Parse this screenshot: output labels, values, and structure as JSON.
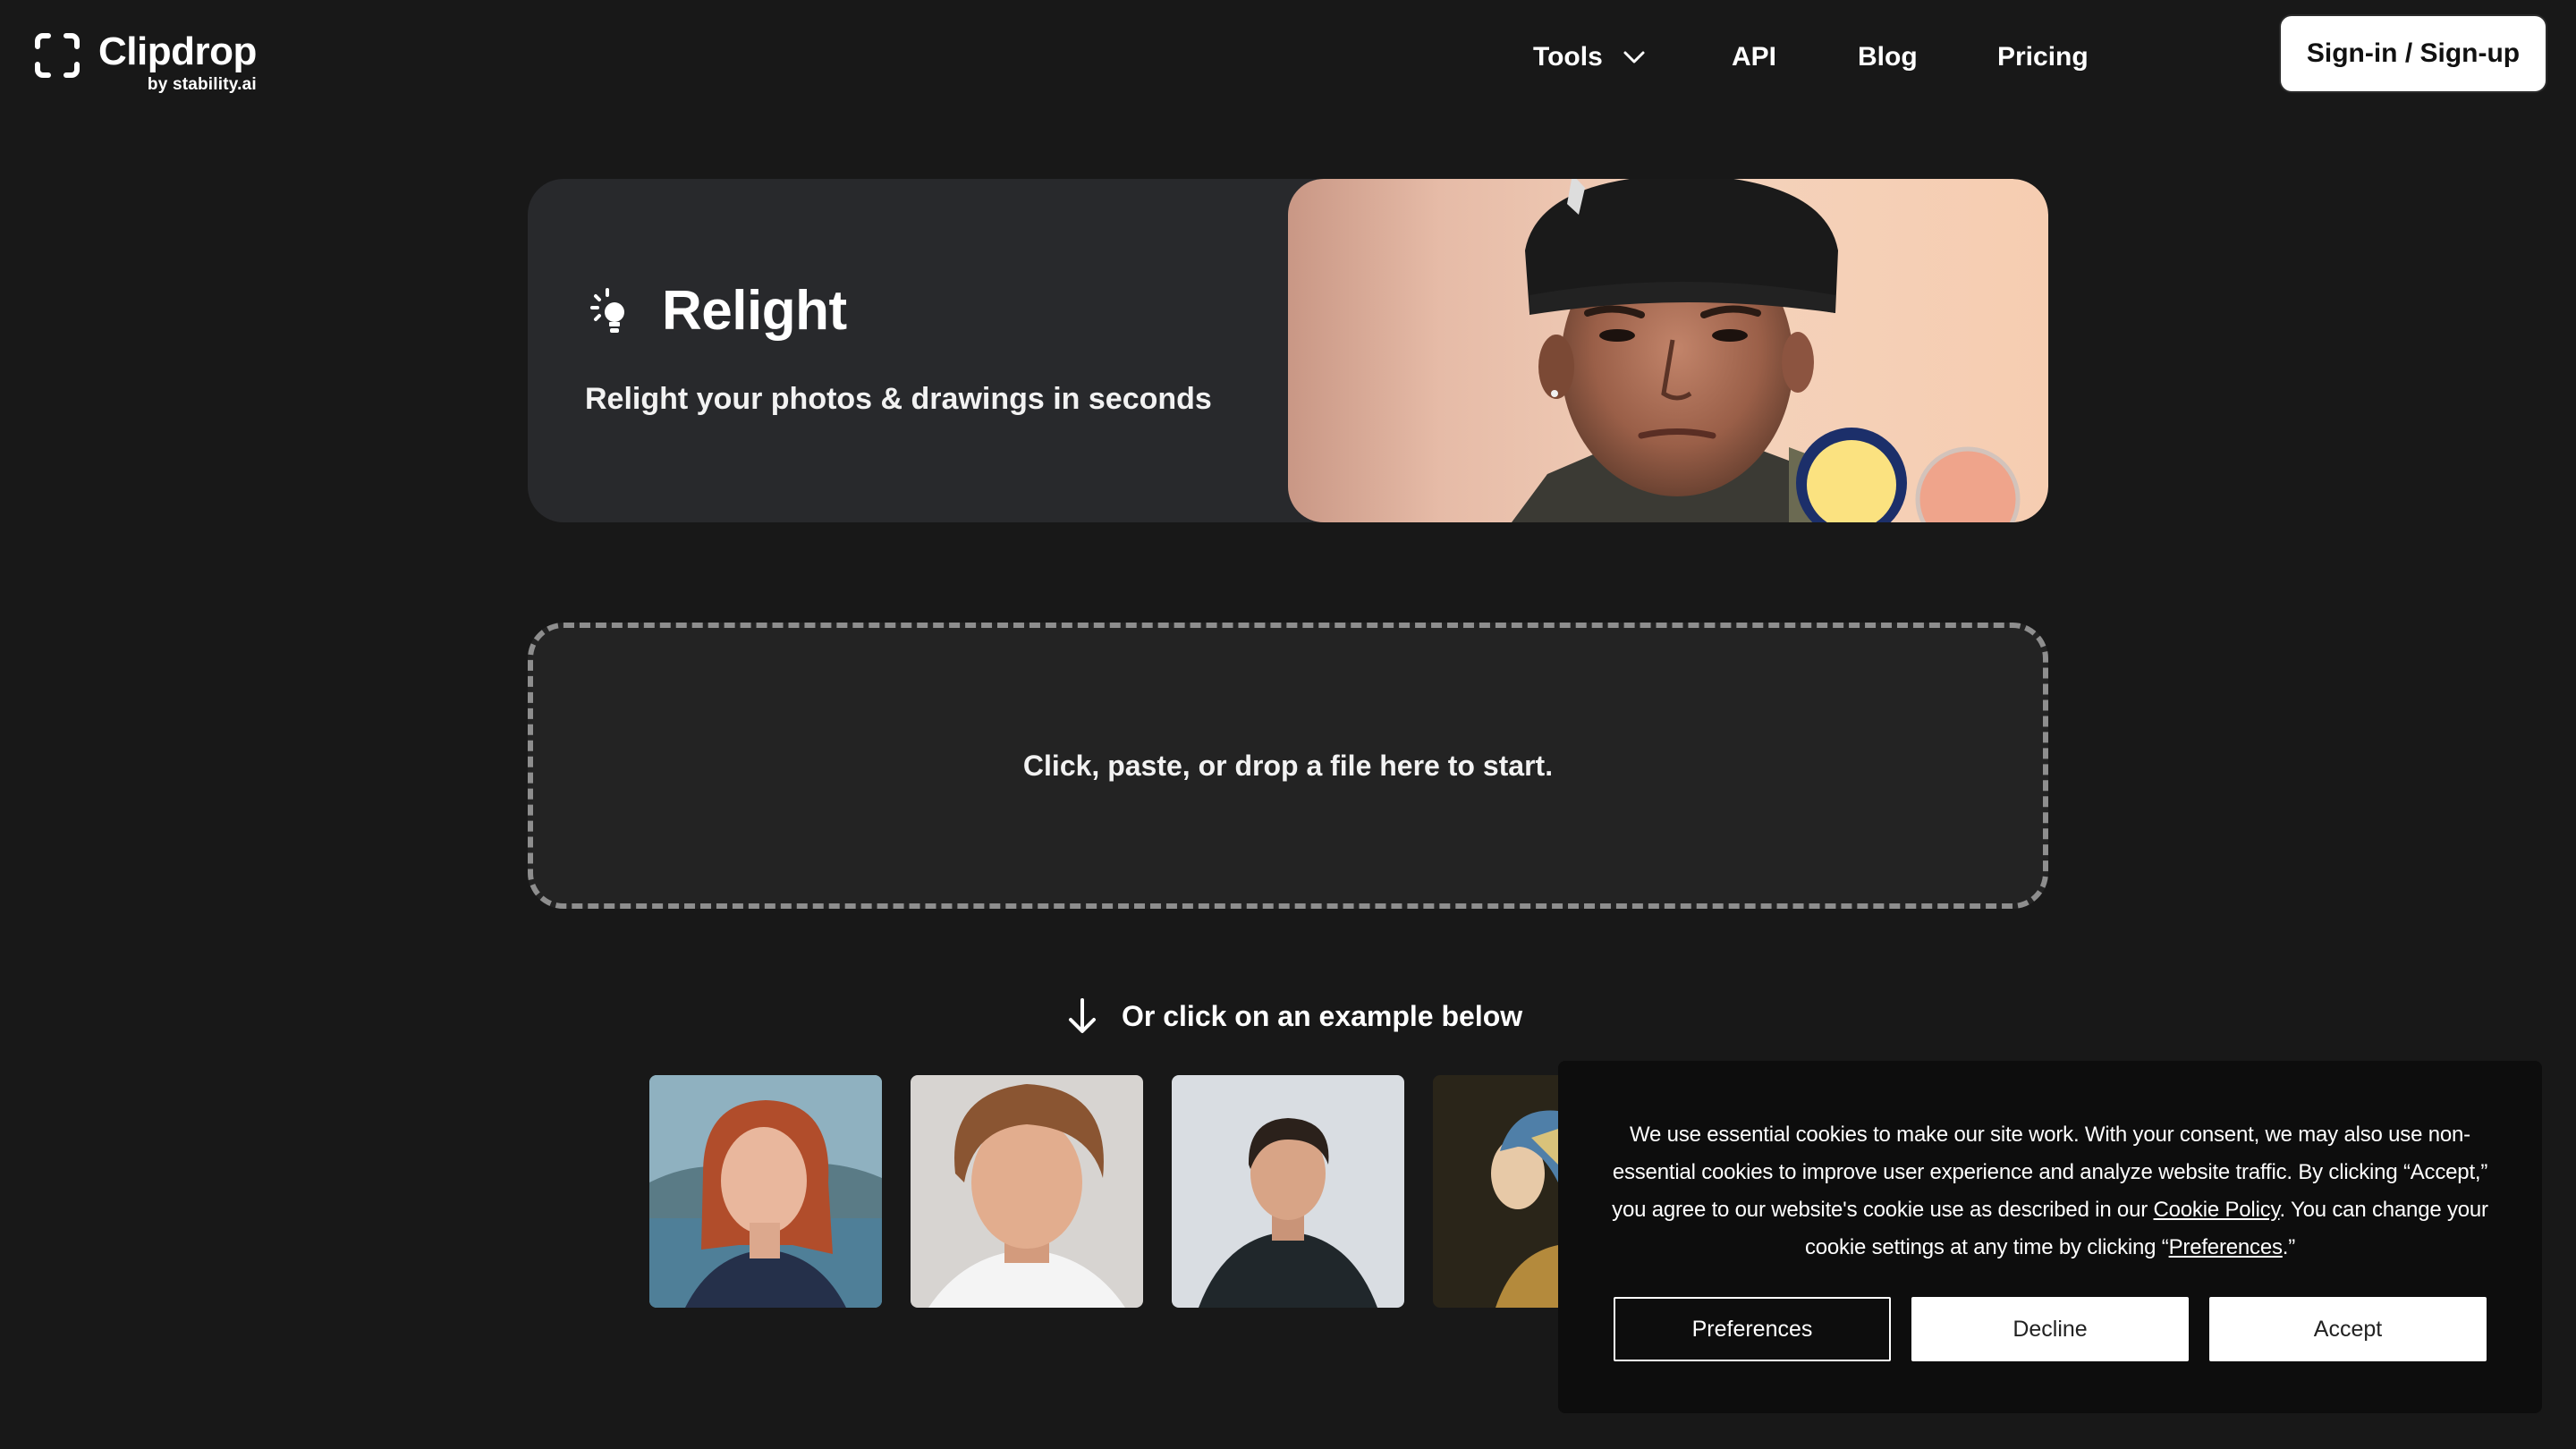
{
  "header": {
    "brand_name": "Clipdrop",
    "brand_byline": "by stability.ai",
    "nav": [
      {
        "label": "Tools",
        "has_dropdown": true
      },
      {
        "label": "API"
      },
      {
        "label": "Blog"
      },
      {
        "label": "Pricing"
      }
    ],
    "signin_label": "Sign-in / Sign-up"
  },
  "hero": {
    "icon": "lightbulb-icon",
    "title": "Relight",
    "subtitle": "Relight your photos & drawings in seconds"
  },
  "dropzone": {
    "text": "Click, paste, or drop a file here to start."
  },
  "examples": {
    "hint_icon": "arrow-down-icon",
    "hint": "Or click on an example below",
    "items": [
      {
        "name": "example-red-haired-woman"
      },
      {
        "name": "example-curly-haired-man"
      },
      {
        "name": "example-man-dark-shirt"
      },
      {
        "name": "example-pearl-earring-painting"
      }
    ]
  },
  "cookie_banner": {
    "text_before_policy": "We use essential cookies to make our site work. With your consent, we may also use non-essential cookies to improve user experience and analyze website traffic. By clicking “Accept,” you agree to our website's cookie use as described in our ",
    "policy_link": "Cookie Policy",
    "text_middle": ". You can change your cookie settings at any time by clicking “",
    "preferences_link": "Preferences",
    "text_after": ".”",
    "buttons": {
      "preferences": "Preferences",
      "decline": "Decline",
      "accept": "Accept"
    }
  },
  "colors": {
    "page_bg": "#181818",
    "card_bg": "#28292c",
    "cookie_bg": "#0d0d0d"
  }
}
